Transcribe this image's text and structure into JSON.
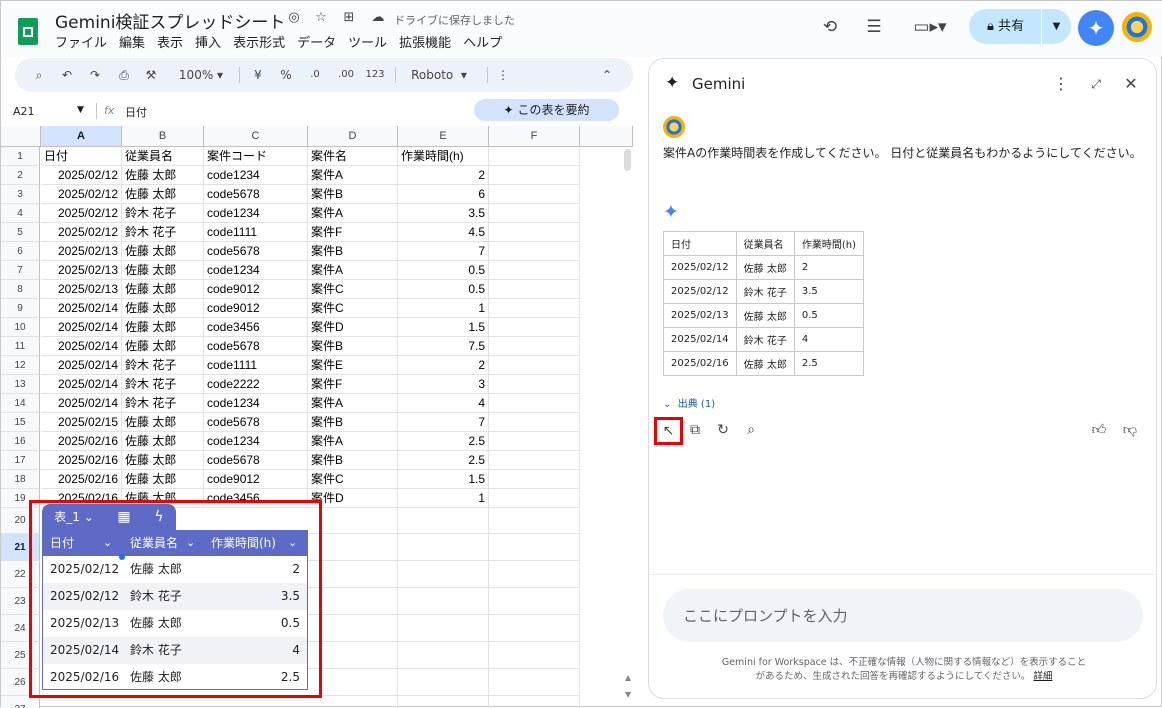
{
  "doc": {
    "title": "Gemini検証スプレッドシート",
    "saved_status": "ドライブに保存しました"
  },
  "menu": [
    "ファイル",
    "編集",
    "表示",
    "挿入",
    "表示形式",
    "データ",
    "ツール",
    "拡張機能",
    "ヘルプ"
  ],
  "header": {
    "share_label": "共有"
  },
  "toolbar": {
    "zoom": "100%",
    "currency": "¥",
    "percent": "%",
    "dec_minus": ".0",
    "dec_plus": ".00",
    "num_format": "123",
    "font": "Roboto"
  },
  "formula_bar": {
    "cell_ref": "A21",
    "fx": "fx",
    "value": "日付",
    "summarize_label": "この表を要約"
  },
  "grid": {
    "columns": [
      "A",
      "B",
      "C",
      "D",
      "E",
      "F"
    ],
    "row_numbers": [
      "1",
      "2",
      "3",
      "4",
      "5",
      "6",
      "7",
      "8",
      "9",
      "10",
      "11",
      "12",
      "13",
      "14",
      "15",
      "16",
      "17",
      "18",
      "19",
      "20",
      "21",
      "22",
      "23",
      "24",
      "25",
      "26",
      "27"
    ],
    "headers": [
      "日付",
      "従業員名",
      "案件コード",
      "案件名",
      "作業時間(h)"
    ],
    "rows": [
      [
        "2025/02/12",
        "佐藤 太郎",
        "code1234",
        "案件A",
        "2"
      ],
      [
        "2025/02/12",
        "佐藤 太郎",
        "code5678",
        "案件B",
        "6"
      ],
      [
        "2025/02/12",
        "鈴木 花子",
        "code1234",
        "案件A",
        "3.5"
      ],
      [
        "2025/02/12",
        "鈴木 花子",
        "code1111",
        "案件F",
        "4.5"
      ],
      [
        "2025/02/13",
        "佐藤 太郎",
        "code5678",
        "案件B",
        "7"
      ],
      [
        "2025/02/13",
        "佐藤 太郎",
        "code1234",
        "案件A",
        "0.5"
      ],
      [
        "2025/02/13",
        "佐藤 太郎",
        "code9012",
        "案件C",
        "0.5"
      ],
      [
        "2025/02/14",
        "佐藤 太郎",
        "code9012",
        "案件C",
        "1"
      ],
      [
        "2025/02/14",
        "佐藤 太郎",
        "code3456",
        "案件D",
        "1.5"
      ],
      [
        "2025/02/14",
        "佐藤 太郎",
        "code5678",
        "案件B",
        "7.5"
      ],
      [
        "2025/02/14",
        "鈴木 花子",
        "code1111",
        "案件E",
        "2"
      ],
      [
        "2025/02/14",
        "鈴木 花子",
        "code2222",
        "案件F",
        "3"
      ],
      [
        "2025/02/14",
        "鈴木 花子",
        "code1234",
        "案件A",
        "4"
      ],
      [
        "2025/02/15",
        "佐藤 太郎",
        "code5678",
        "案件B",
        "7"
      ],
      [
        "2025/02/16",
        "佐藤 太郎",
        "code1234",
        "案件A",
        "2.5"
      ],
      [
        "2025/02/16",
        "佐藤 太郎",
        "code5678",
        "案件B",
        "2.5"
      ],
      [
        "2025/02/16",
        "佐藤 太郎",
        "code9012",
        "案件C",
        "1.5"
      ],
      [
        "2025/02/16",
        "佐藤 太郎",
        "code3456",
        "案件D",
        "1"
      ]
    ]
  },
  "inserted_table": {
    "name": "表_1",
    "headers": [
      "日付",
      "従業員名",
      "作業時間(h)"
    ],
    "rows": [
      [
        "2025/02/12",
        "佐藤 太郎",
        "2"
      ],
      [
        "2025/02/12",
        "鈴木 花子",
        "3.5"
      ],
      [
        "2025/02/13",
        "佐藤 太郎",
        "0.5"
      ],
      [
        "2025/02/14",
        "鈴木 花子",
        "4"
      ],
      [
        "2025/02/16",
        "佐藤 太郎",
        "2.5"
      ]
    ]
  },
  "gemini": {
    "title": "Gemini",
    "prompt": "案件Aの作業時間表を作成してください。 日付と従業員名もわかるようにしてください。",
    "table_headers": [
      "日付",
      "従業員名",
      "作業時間(h)"
    ],
    "table_rows": [
      [
        "2025/02/12",
        "佐藤 太郎",
        "2"
      ],
      [
        "2025/02/12",
        "鈴木 花子",
        "3.5"
      ],
      [
        "2025/02/13",
        "佐藤 太郎",
        "0.5"
      ],
      [
        "2025/02/14",
        "鈴木 花子",
        "4"
      ],
      [
        "2025/02/16",
        "佐藤 太郎",
        "2.5"
      ]
    ],
    "source_label": "出典 (1)",
    "input_placeholder": "ここにプロンプトを入力",
    "disclaimer": "Gemini for Workspace は、不正確な情報（人物に関する情報など）を表示することがあるため、生成された回答を再確認するようにしてください。",
    "details_link": "詳細"
  },
  "colors": {
    "accent": "#5d6ac6",
    "highlight_border": "#e00000",
    "share_bg": "#c2e7ff",
    "selected_header": "#d3e3fd"
  }
}
